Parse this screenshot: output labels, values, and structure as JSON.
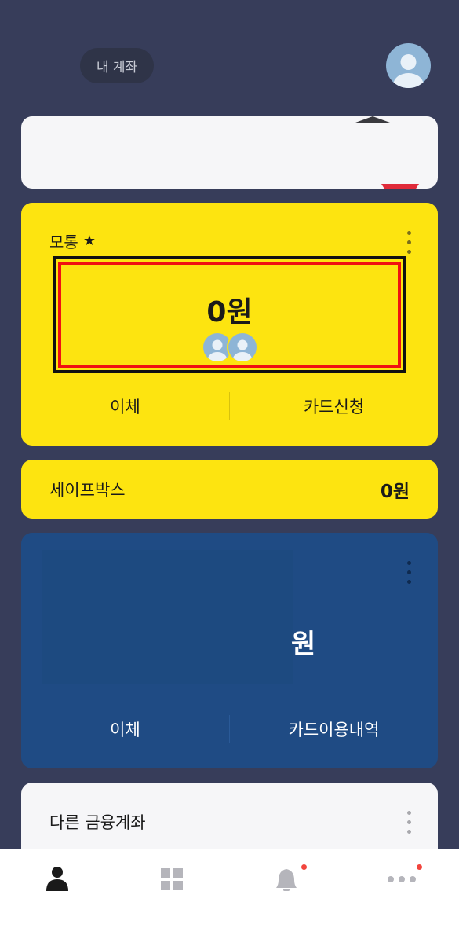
{
  "header": {
    "account_chip": "내 계좌",
    "profile_icon": "avatar-icon"
  },
  "main_account": {
    "name": "모통",
    "favorite_icon": "star-icon",
    "balance": "0원",
    "actions": [
      "이체",
      "카드신청"
    ]
  },
  "safebox": {
    "label": "세이프박스",
    "amount": "0원"
  },
  "blue_account": {
    "balance_unit": "원",
    "actions": [
      "이체",
      "카드이용내역"
    ]
  },
  "other_accounts": {
    "label": "다른 금융계좌"
  },
  "tabbar": {
    "items": [
      {
        "icon": "person-icon",
        "active": true
      },
      {
        "icon": "grid-icon",
        "active": false
      },
      {
        "icon": "bell-icon",
        "badge": true
      },
      {
        "icon": "more-icon",
        "badge": true
      }
    ]
  },
  "colors": {
    "background": "#373d5a",
    "yellow": "#fde410",
    "blue": "#1f4b84",
    "badge": "#f2453d"
  }
}
